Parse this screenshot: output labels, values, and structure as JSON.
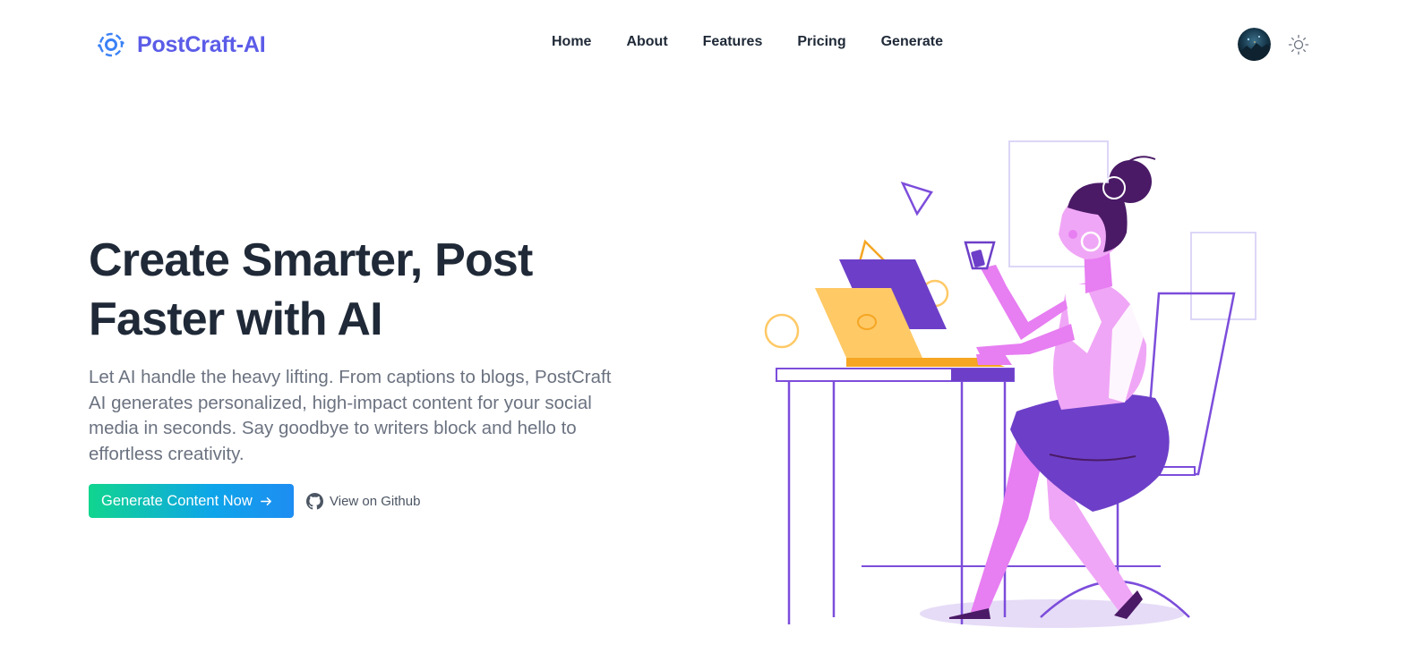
{
  "brand": {
    "name": "PostCraft-AI",
    "logo_icon": "orbit-logo-icon",
    "color": "#5b5ce8"
  },
  "nav": {
    "links": [
      {
        "label": "Home"
      },
      {
        "label": "About"
      },
      {
        "label": "Features"
      },
      {
        "label": "Pricing"
      },
      {
        "label": "Generate"
      }
    ]
  },
  "header_actions": {
    "avatar_icon": "user-avatar",
    "theme_icon": "sun-icon"
  },
  "hero": {
    "title": "Create Smarter, Post Faster with AI",
    "description": "Let AI handle the heavy lifting. From captions to blogs, PostCraft AI generates personalized, high-impact content for your social media in seconds. Say goodbye to writers block and hello to effortless creativity.",
    "cta_label": "Generate Content Now",
    "cta_icon": "arrow-right-icon",
    "github_label": "View on Github",
    "github_icon": "github-icon"
  },
  "colors": {
    "text_dark": "#1f2937",
    "text_muted": "#6b7280",
    "cta_gradient_start": "#10d58e",
    "cta_gradient_end": "#1e8df2",
    "illustration_purple": "#6d3fc8",
    "illustration_pink": "#e77ef2",
    "illustration_yellow": "#ffc966"
  }
}
